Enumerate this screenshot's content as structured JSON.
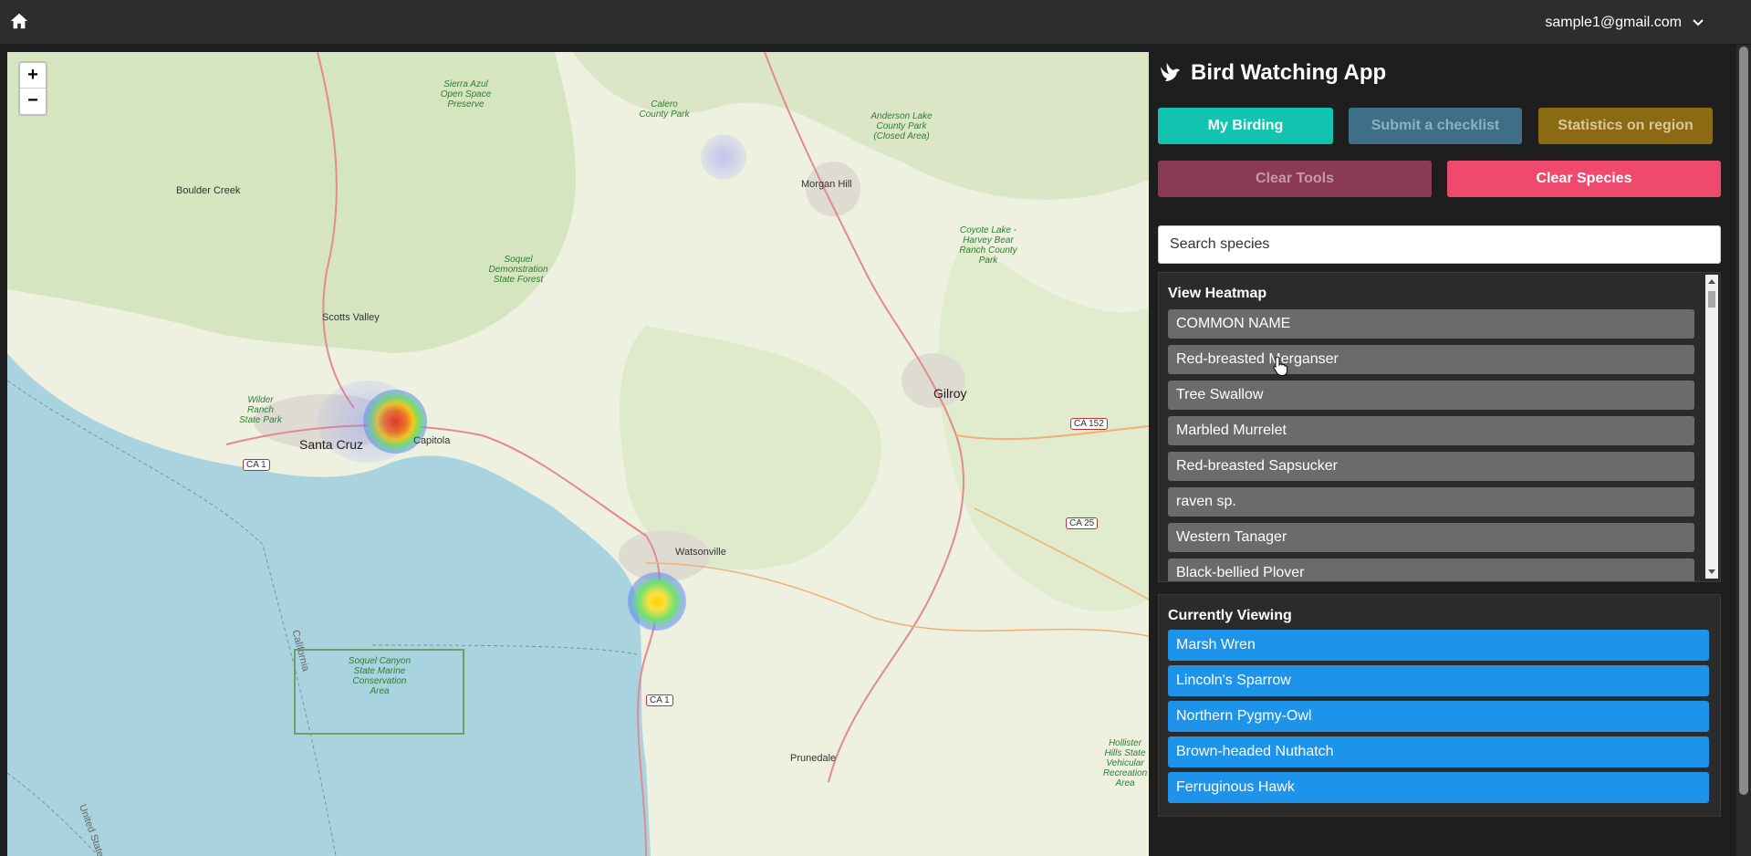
{
  "topbar": {
    "user_email": "sample1@gmail.com"
  },
  "icons": {
    "home": "home-icon",
    "dropdown": "chevron-down-icon",
    "logo": "dove-icon"
  },
  "map": {
    "zoom_in": "+",
    "zoom_out": "−",
    "places": {
      "boulder_creek": "Boulder Creek",
      "scotts_valley": "Scotts Valley",
      "santa_cruz": "Santa Cruz",
      "capitola": "Capitola",
      "watsonville": "Watsonville",
      "morgan_hill": "Morgan Hill",
      "gilroy": "Gilroy",
      "prunedale": "Prunedale",
      "calero": "Calero County Park",
      "anderson": "Anderson Lake County Park (Closed Area)",
      "sierra_azul": "Sierra Azul Open Space Preserve",
      "soquel_forest": "Soquel Demonstration State Forest",
      "wilder": "Wilder Ranch State Park",
      "coyote": "Coyote Lake - Harvey Bear Ranch County Park",
      "soquel_canyon": "Soquel Canyon State Marine Conservation Area",
      "hollister": "Hollister Hills State Vehicular Recreation Area",
      "california": "California",
      "united_states": "United States"
    },
    "shields": {
      "ca1_north": "CA 1",
      "ca1_south": "CA 1",
      "ca152": "CA 152",
      "ca25": "CA 25"
    }
  },
  "app": {
    "title": "Bird Watching App"
  },
  "buttons": {
    "my_birding": "My Birding",
    "submit_checklist": "Submit a checklist",
    "statistics": "Statistics on region",
    "clear_tools": "Clear Tools",
    "clear_species": "Clear Species"
  },
  "colors": {
    "my_birding": "#12c3b0",
    "submit_checklist": "#3f6f86",
    "statistics": "#8a6b13",
    "clear_tools": "#8a3a52",
    "clear_species": "#ef4a6e",
    "selected_species": "#1e93ea"
  },
  "search": {
    "placeholder": "Search species"
  },
  "heatmap_list": {
    "title": "View Heatmap",
    "items": [
      "COMMON NAME",
      "Red-breasted Merganser",
      "Tree Swallow",
      "Marbled Murrelet",
      "Red-breasted Sapsucker",
      "raven sp.",
      "Western Tanager",
      "Black-bellied Plover"
    ]
  },
  "currently_viewing": {
    "title": "Currently Viewing",
    "items": [
      "Marsh Wren",
      "Lincoln's Sparrow",
      "Northern Pygmy-Owl",
      "Brown-headed Nuthatch",
      "Ferruginous Hawk"
    ]
  }
}
